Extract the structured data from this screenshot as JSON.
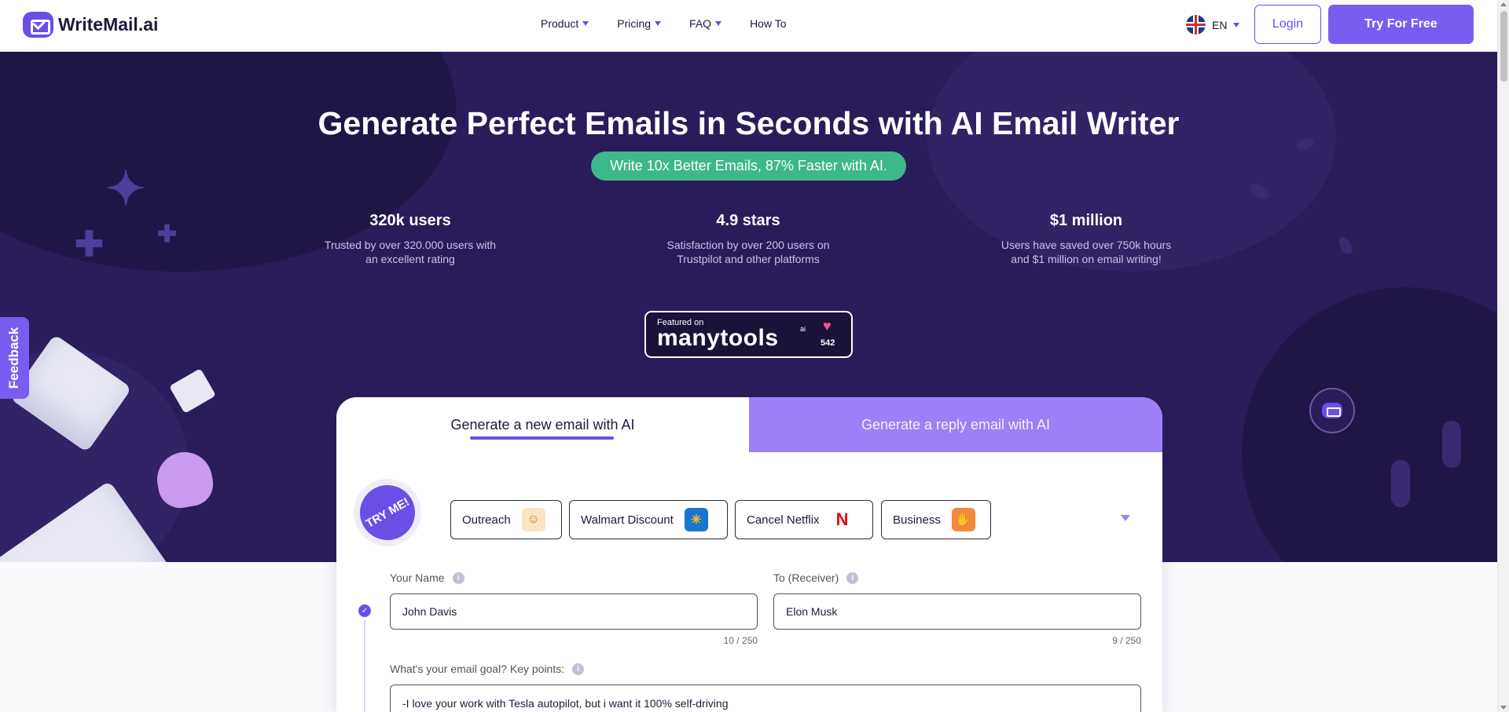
{
  "header": {
    "logo_text": "WriteMail.ai",
    "nav": [
      {
        "label": "Product",
        "has_caret": true
      },
      {
        "label": "Pricing",
        "has_caret": true
      },
      {
        "label": "FAQ",
        "has_caret": true
      },
      {
        "label": "How To",
        "has_caret": false
      }
    ],
    "language": "EN",
    "login_label": "Login",
    "try_label": "Try For Free"
  },
  "hero": {
    "title": "Generate Perfect Emails in Seconds with AI Email Writer",
    "pill": "Write 10x Better Emails, 87% Faster with AI.",
    "stats": [
      {
        "value": "320k users",
        "desc": "Trusted by over 320.000 users with an excellent rating"
      },
      {
        "value": "4.9 stars",
        "desc": "Satisfaction by over 200 users on Trustpilot and other platforms"
      },
      {
        "value": "$1 million",
        "desc": "Users have saved over 750k hours and $1 million on email writing!"
      }
    ],
    "manytools": {
      "featured": "Featured on",
      "name": "manytools",
      "ai": "ai",
      "count": "542"
    },
    "feedback_label": "Feedback"
  },
  "card": {
    "tabs": {
      "new": "Generate a new email with AI",
      "reply": "Generate a reply email with AI"
    },
    "tryme": "TRY ME!",
    "chips": [
      {
        "label": "Outreach",
        "icon": "person-icon",
        "color": "#f2a93b"
      },
      {
        "label": "Walmart Discount",
        "icon": "walmart-icon",
        "color": "#1a75cf"
      },
      {
        "label": "Cancel Netflix",
        "icon": "netflix-icon",
        "color": "#e50914"
      },
      {
        "label": "Business",
        "icon": "handshake-icon",
        "color": "#f08a3c"
      }
    ],
    "fields": {
      "your_name": {
        "label": "Your Name",
        "value": "John Davis",
        "counter": "10 / 250"
      },
      "to_receiver": {
        "label": "To (Receiver)",
        "value": "Elon Musk",
        "counter": "9 / 250"
      },
      "goal": {
        "label": "What's your email goal? Key points:",
        "value": "-I love your work with Tesla autopilot, but i want it 100% self-driving"
      }
    }
  },
  "colors": {
    "brand": "#6b4ee6",
    "hero_bg": "#2a1c5a",
    "pill_green": "#3db88b"
  }
}
